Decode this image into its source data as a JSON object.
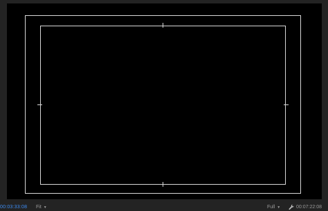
{
  "monitor": {
    "current_timecode": "00:03:33:08",
    "fit_label": "Fit",
    "resolution_label": "Full",
    "duration_timecode": "00:07:22:08",
    "icons": {
      "fit_dropdown": "chevron-down-icon",
      "resolution_dropdown": "chevron-down-icon",
      "settings": "wrench-icon"
    },
    "colors": {
      "timecode_accent": "#3d8df5",
      "viewer_background": "#000000",
      "panel_background": "#232323",
      "guide_lines": "#d8d8d8"
    }
  }
}
